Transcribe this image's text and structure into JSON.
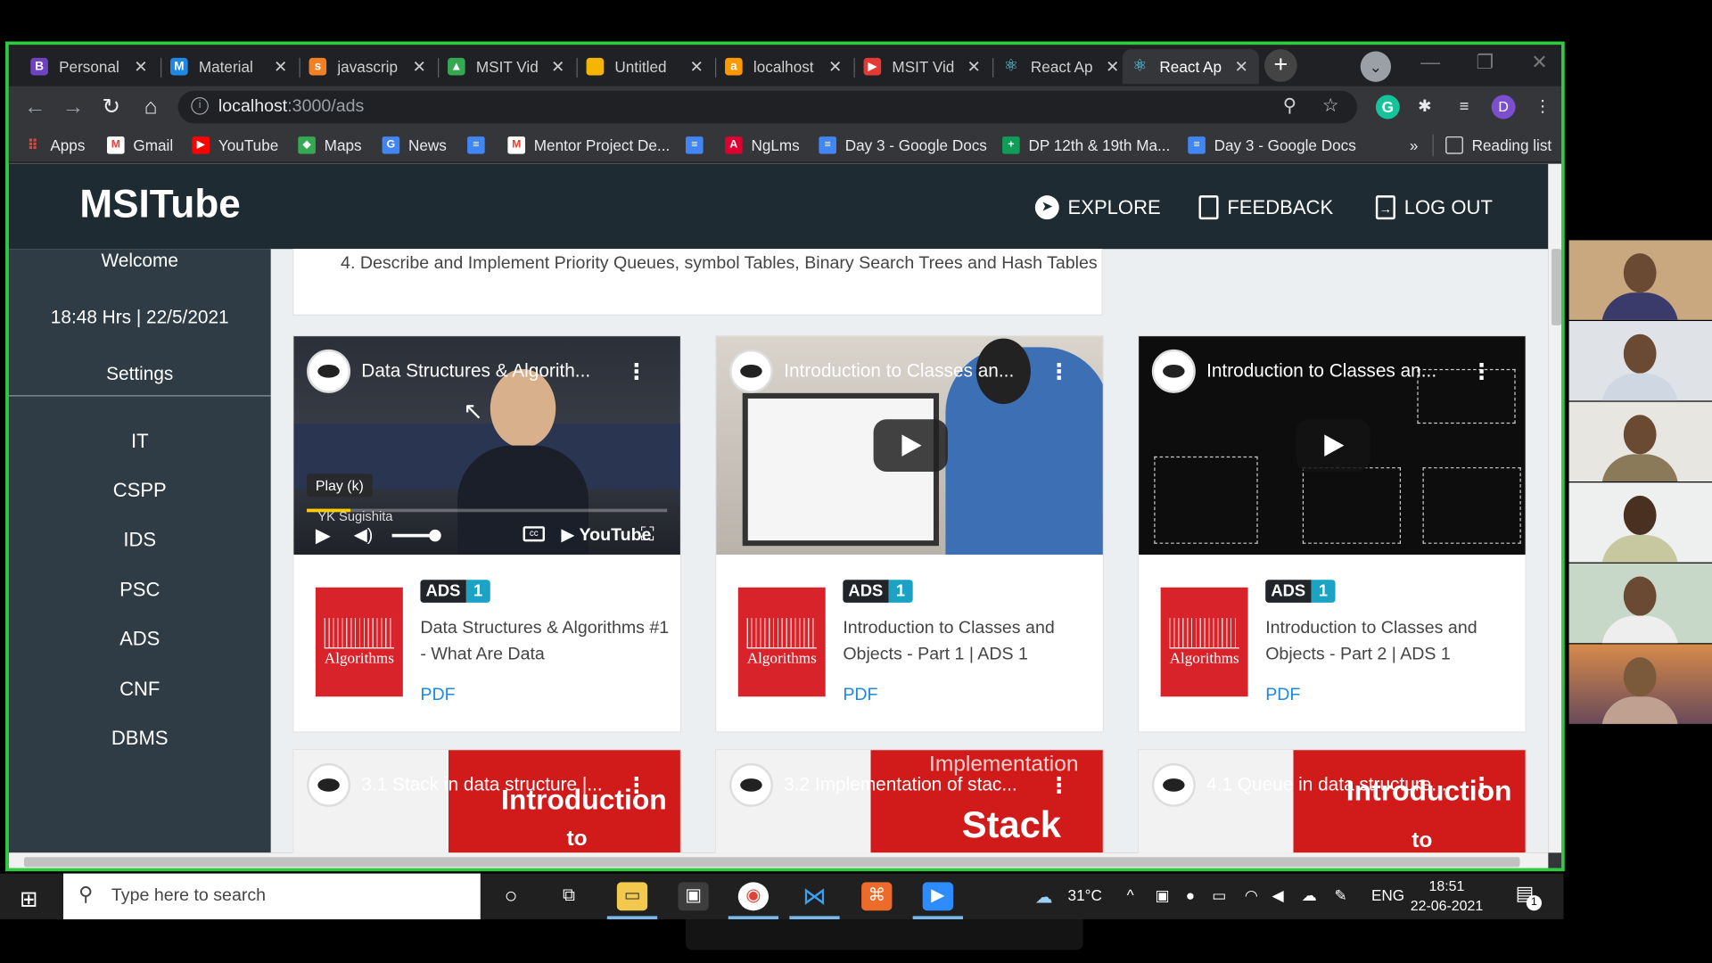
{
  "browser": {
    "tabs": [
      {
        "label": "Personal",
        "icon": "B",
        "color": "#6f42c1"
      },
      {
        "label": "Material",
        "icon": "mui",
        "color": "#1e88e5"
      },
      {
        "label": "javascrip",
        "icon": "so",
        "color": "#f48024"
      },
      {
        "label": "MSIT Vid",
        "icon": "drive",
        "color": "#34a853"
      },
      {
        "label": "Untitled",
        "icon": "slides",
        "color": "#f4b400"
      },
      {
        "label": "localhost",
        "icon": "aws",
        "color": "#ff9900"
      },
      {
        "label": "MSIT Vid",
        "icon": "yt",
        "color": "#e53935"
      },
      {
        "label": "React Ap",
        "icon": "react",
        "color": "#61dafb"
      },
      {
        "label": "React Ap",
        "icon": "react",
        "color": "#61dafb"
      }
    ],
    "active_tab": 8,
    "url_host": "localhost",
    "url_path": ":3000/ads",
    "profile_initial": "D",
    "bookmarks": [
      {
        "label": "Apps",
        "icon": "apps-icon",
        "color": "#ea4335"
      },
      {
        "label": "Gmail",
        "icon": "gmail-icon",
        "color": "#ea4335"
      },
      {
        "label": "YouTube",
        "icon": "youtube-icon",
        "color": "#ff0000"
      },
      {
        "label": "Maps",
        "icon": "maps-icon",
        "color": "#34a853"
      },
      {
        "label": "News",
        "icon": "news-icon",
        "color": "#4285f4"
      },
      {
        "label": "",
        "icon": "docs-icon",
        "color": "#4285f4"
      },
      {
        "label": "Mentor Project De...",
        "icon": "gmail-icon",
        "color": "#ea4335"
      },
      {
        "label": "",
        "icon": "docs-icon",
        "color": "#4285f4"
      },
      {
        "label": "NgLms",
        "icon": "angular-icon",
        "color": "#dd0031"
      },
      {
        "label": "Day 3 - Google Docs",
        "icon": "docs-icon",
        "color": "#4285f4"
      },
      {
        "label": "DP 12th & 19th Ma...",
        "icon": "sheets-icon",
        "color": "#0f9d58"
      },
      {
        "label": "Day 3 - Google Docs",
        "icon": "docs-icon",
        "color": "#4285f4"
      }
    ],
    "bookmarks_more": "»",
    "reading_list": "Reading list"
  },
  "app": {
    "brand": "MSITube",
    "nav": {
      "explore": "EXPLORE",
      "feedback": "FEEDBACK",
      "logout": "LOG OUT"
    },
    "sidebar": {
      "welcome": "Welcome",
      "datetime": "18:48 Hrs | 22/5/2021",
      "settings": "Settings",
      "subjects": [
        "IT",
        "CSPP",
        "IDS",
        "PSC",
        "ADS",
        "CNF",
        "DBMS"
      ]
    },
    "objective": "4. Describe and Implement Priority Queues, symbol Tables, Binary Search Trees and Hash Tables",
    "videos": [
      {
        "video_title": "Data Structures & Algorith...",
        "tooltip": "Play (k)",
        "presenter": "YK Sugishita",
        "subject": "ADS",
        "unit": "1",
        "title": "Data Structures & Algorithms #1 - What Are Data",
        "link": "PDF",
        "book": "Algorithms"
      },
      {
        "video_title": "Introduction to Classes an...",
        "subject": "ADS",
        "unit": "1",
        "title": "Introduction to Classes and Objects - Part 1 | ADS 1",
        "link": "PDF",
        "book": "Algorithms"
      },
      {
        "video_title": "Introduction to Classes an...",
        "subject": "ADS",
        "unit": "1",
        "title": "Introduction to Classes and Objects - Part 2 | ADS 1",
        "link": "PDF",
        "book": "Algorithms"
      }
    ],
    "next_videos": [
      {
        "video_title": "3.1 Stack in data structure |...",
        "overlay1": "Introduction",
        "overlay2": "to"
      },
      {
        "video_title": "3.2 Implementation of stac...",
        "overlay1": "Implementation",
        "overlay2": "Stack"
      },
      {
        "video_title": "4.1 Queue in data structure...",
        "overlay1": "Introduction",
        "overlay2": "to"
      }
    ]
  },
  "taskbar": {
    "search_placeholder": "Type here to search",
    "weather": "31°C",
    "language": "ENG",
    "time": "18:51",
    "date": "22-06-2021",
    "notifications": "1"
  }
}
